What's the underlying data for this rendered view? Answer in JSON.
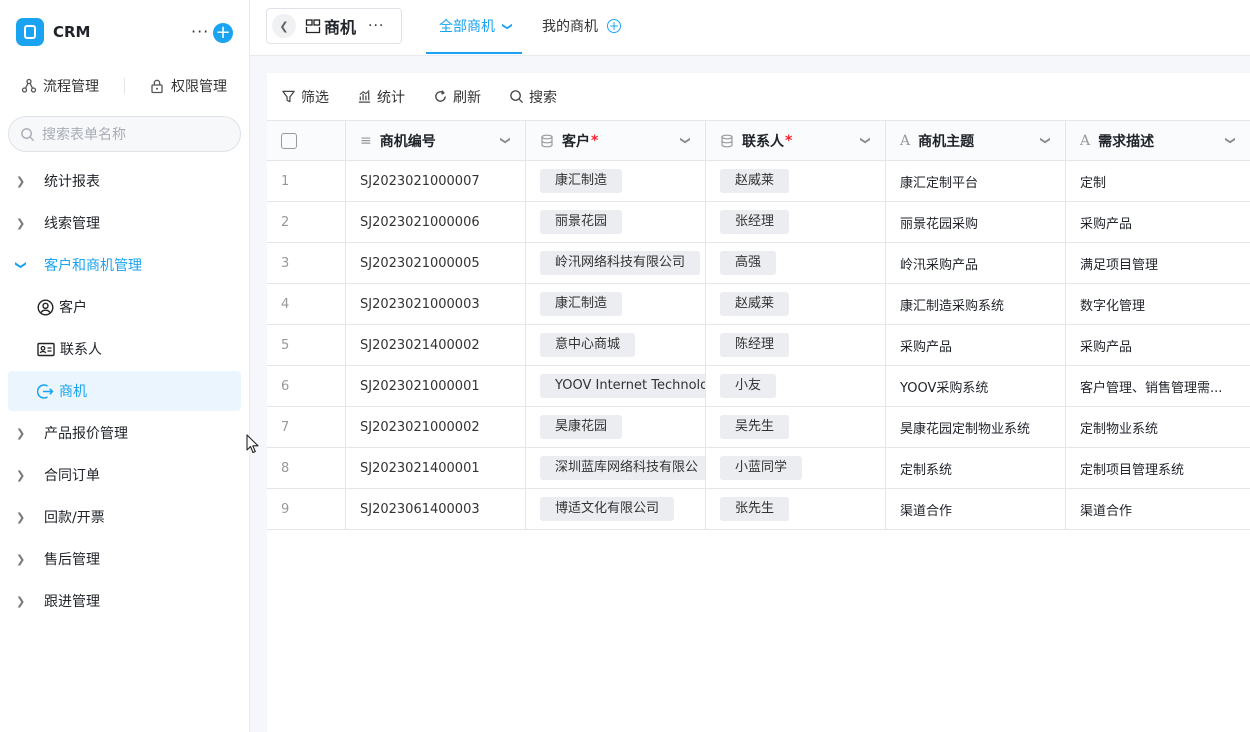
{
  "sidebar": {
    "app_name": "CRM",
    "quick_links": [
      "流程管理",
      "权限管理"
    ],
    "search_placeholder": "搜索表单名称",
    "nav": [
      {
        "label": "统计报表"
      },
      {
        "label": "线索管理"
      },
      {
        "label": "客户和商机管理",
        "expanded": true
      },
      {
        "label": "产品报价管理"
      },
      {
        "label": "合同订单"
      },
      {
        "label": "回款/开票"
      },
      {
        "label": "售后管理"
      },
      {
        "label": "跟进管理"
      }
    ],
    "sub_items": [
      {
        "label": "客户",
        "icon": "user-circle-icon"
      },
      {
        "label": "联系人",
        "icon": "contact-card-icon"
      },
      {
        "label": "商机",
        "icon": "opportunity-icon",
        "active": true
      }
    ],
    "accent": "#1aa3f0"
  },
  "header": {
    "title": "商机",
    "tabs": [
      {
        "label": "全部商机",
        "active": true
      },
      {
        "label": "我的商机"
      }
    ]
  },
  "toolbar": {
    "filter": "筛选",
    "stats": "统计",
    "refresh": "刷新",
    "search": "搜索"
  },
  "table": {
    "columns": [
      {
        "label": "商机编号",
        "icon": "number-list-icon",
        "required": false
      },
      {
        "label": "客户",
        "icon": "database-icon",
        "required": true
      },
      {
        "label": "联系人",
        "icon": "database-icon",
        "required": true
      },
      {
        "label": "商机主题",
        "icon": "text-icon",
        "required": false
      },
      {
        "label": "需求描述",
        "icon": "text-icon",
        "required": false
      }
    ],
    "rows": [
      {
        "n": "1",
        "id": "SJ2023021000007",
        "customer": "康汇制造",
        "contact": "赵威莱",
        "topic": "康汇定制平台",
        "desc": "定制"
      },
      {
        "n": "2",
        "id": "SJ2023021000006",
        "customer": "丽景花园",
        "contact": "张经理",
        "topic": "丽景花园采购",
        "desc": "采购产品"
      },
      {
        "n": "3",
        "id": "SJ2023021000005",
        "customer": "岭汛网络科技有限公司",
        "contact": "高强",
        "topic": "岭汛采购产品",
        "desc": "满足项目管理"
      },
      {
        "n": "4",
        "id": "SJ2023021000003",
        "customer": "康汇制造",
        "contact": "赵威莱",
        "topic": "康汇制造采购系统",
        "desc": "数字化管理"
      },
      {
        "n": "5",
        "id": "SJ2023021400002",
        "customer": "意中心商城",
        "contact": "陈经理",
        "topic": "采购产品",
        "desc": "采购产品"
      },
      {
        "n": "6",
        "id": "SJ2023021000001",
        "customer": "YOOV Internet Technolo",
        "contact": "小友",
        "topic": "YOOV采购系统",
        "desc": "客户管理、销售管理需..."
      },
      {
        "n": "7",
        "id": "SJ2023021000002",
        "customer": "昊康花园",
        "contact": "吴先生",
        "topic": "昊康花园定制物业系统",
        "desc": "定制物业系统"
      },
      {
        "n": "8",
        "id": "SJ2023021400001",
        "customer": "深圳蓝库网络科技有限公",
        "contact": "小蓝同学",
        "topic": "定制系统",
        "desc": "定制项目管理系统"
      },
      {
        "n": "9",
        "id": "SJ2023061400003",
        "customer": "博适文化有限公司",
        "contact": "张先生",
        "topic": "渠道合作",
        "desc": "渠道合作"
      }
    ]
  }
}
